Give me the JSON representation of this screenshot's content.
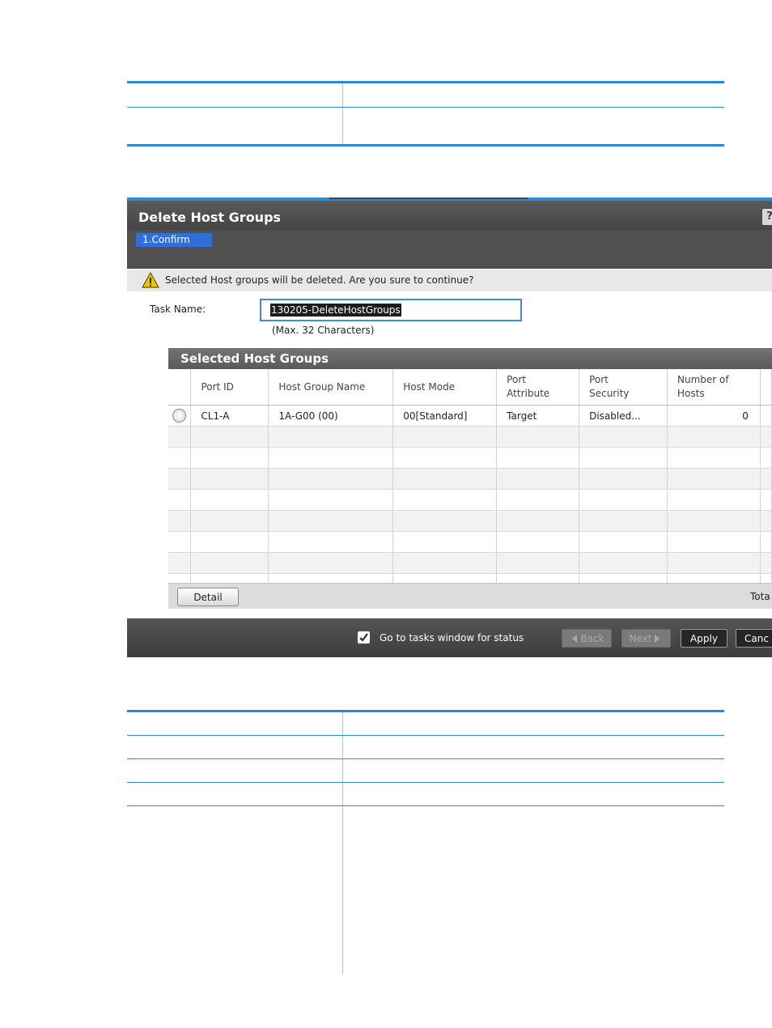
{
  "dialog": {
    "title": "Delete Host Groups",
    "step": "1.Confirm",
    "warning": "Selected Host groups will be deleted. Are you sure to continue?",
    "task_name_label": "Task Name:",
    "task_name_value": "130205-DeleteHostGroups",
    "task_name_hint": "(Max. 32 Characters)",
    "help_glyph": "?"
  },
  "panel": {
    "title": "Selected Host Groups",
    "columns": [
      {
        "line1": "Port ID",
        "line2": ""
      },
      {
        "line1": "Host Group Name",
        "line2": ""
      },
      {
        "line1": "Host Mode",
        "line2": ""
      },
      {
        "line1": "Port",
        "line2": "Attribute"
      },
      {
        "line1": "Port",
        "line2": "Security"
      },
      {
        "line1": "Number of",
        "line2": "Hosts"
      }
    ],
    "rows": [
      {
        "port_id": "CL1-A",
        "host_group_name": "1A-G00 (00)",
        "host_mode": "00[Standard]",
        "port_attribute": "Target",
        "port_security": "Disabled...",
        "number_of_hosts": "0"
      }
    ],
    "detail_label": "Detail",
    "total_label": "Tota"
  },
  "footer": {
    "checkbox_label": "Go to tasks window for status",
    "checkbox_checked": true,
    "back_label": "Back",
    "next_label": "Next",
    "apply_label": "Apply",
    "cancel_label": "Canc"
  },
  "colors": {
    "accent_blue": "#2b8ad3",
    "step_chip": "#2f6fd7",
    "title_bar": "#4f4f4f"
  }
}
